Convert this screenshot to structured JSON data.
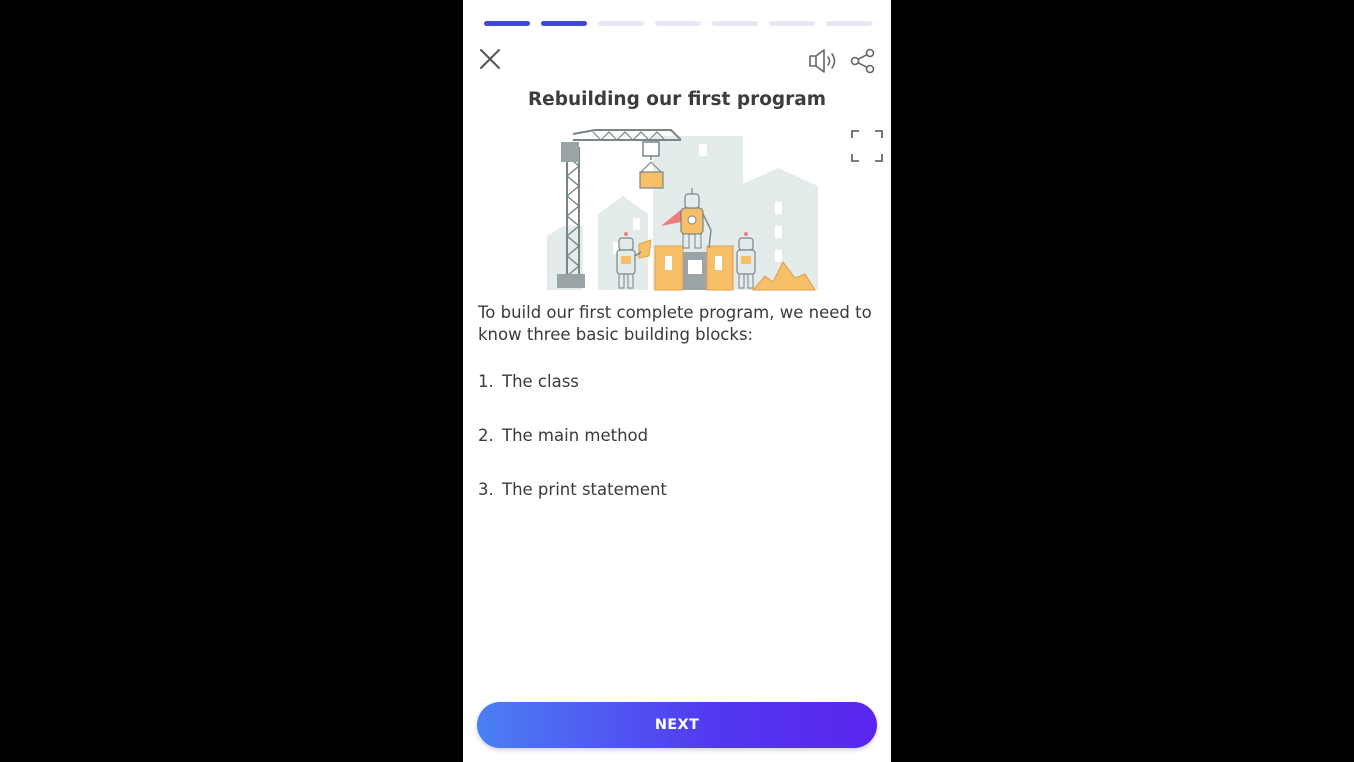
{
  "progress": {
    "total_steps": 7,
    "completed_steps": 2
  },
  "header": {
    "close_icon": "close-icon",
    "sound_icon": "speaker-icon",
    "share_icon": "share-icon"
  },
  "lesson": {
    "title": "Rebuilding our first program",
    "illustration": "robots-building-city-illustration",
    "fullscreen_icon": "fullscreen-icon",
    "intro": "To build our first complete program, we need to know three basic building blocks:",
    "items": [
      {
        "num": "1.",
        "text": "The class"
      },
      {
        "num": "2.",
        "text": "The main method"
      },
      {
        "num": "3.",
        "text": "The print statement"
      }
    ]
  },
  "footer": {
    "next_label": "NEXT"
  },
  "colors": {
    "accent": "#3f49d6",
    "button_start": "#4a80f2",
    "button_end": "#5a25ee"
  }
}
